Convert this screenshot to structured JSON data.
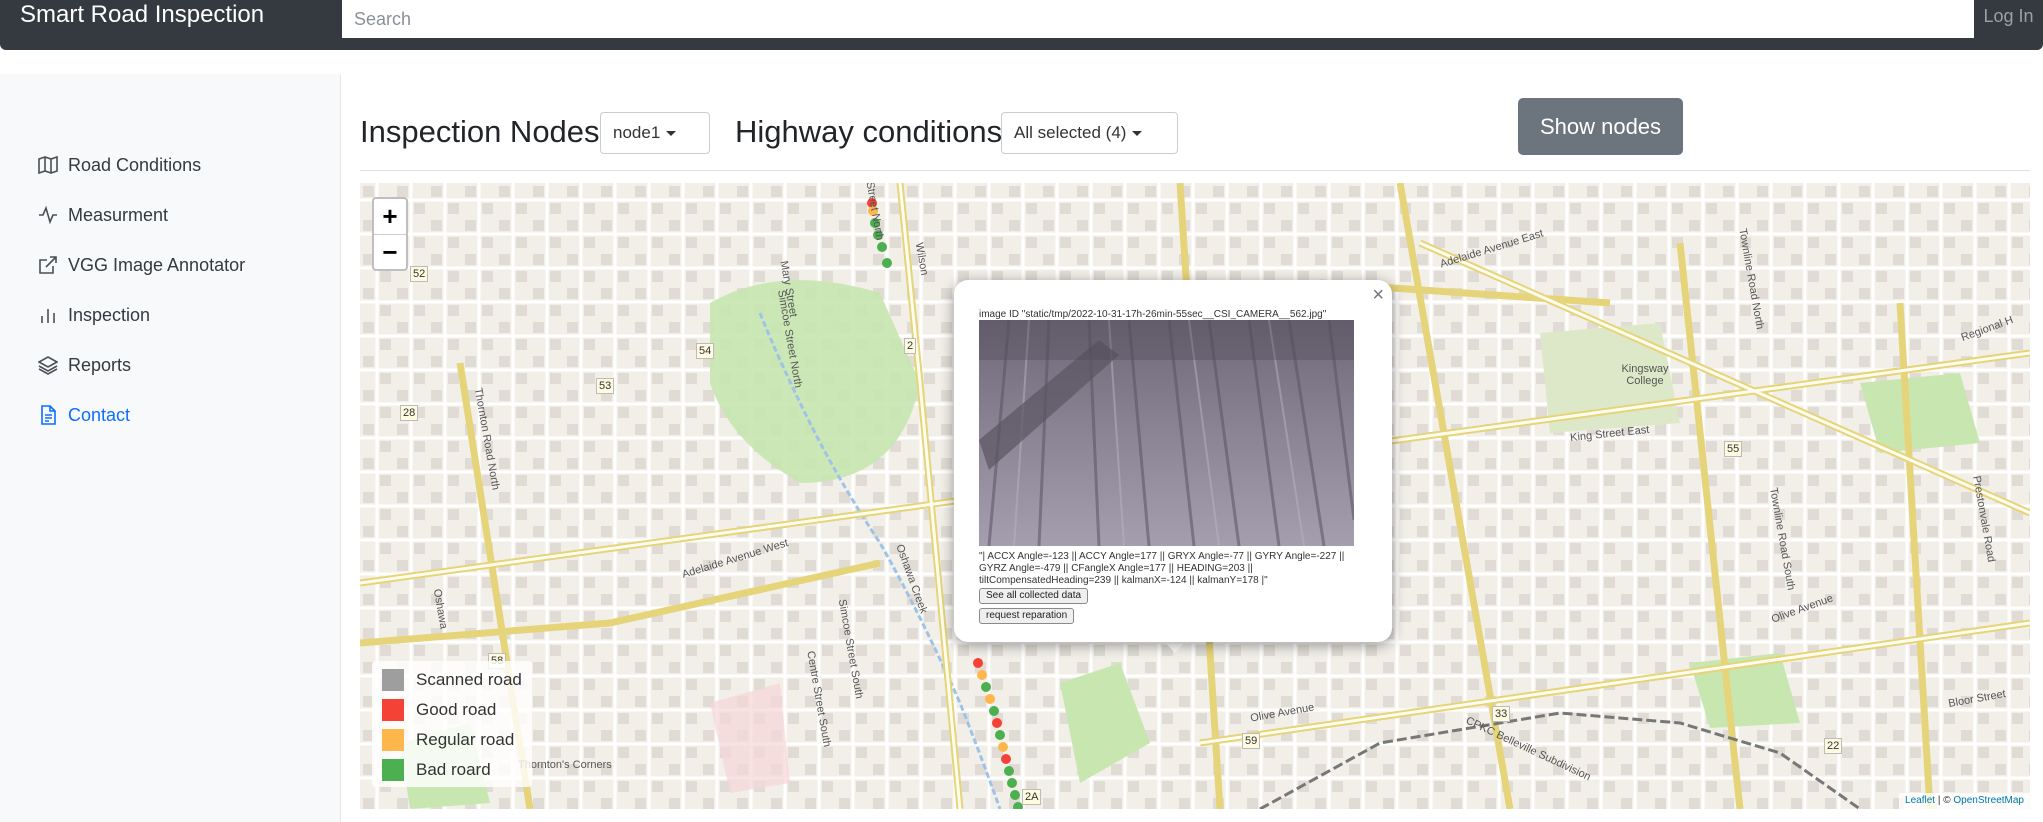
{
  "navbar": {
    "brand": "Smart Road Inspection",
    "search_placeholder": "Search",
    "login_label": "Log In"
  },
  "sidebar": {
    "items": [
      {
        "label": "Road Conditions",
        "icon": "map-icon"
      },
      {
        "label": "Measurment",
        "icon": "activity-icon"
      },
      {
        "label": "VGG Image Annotator",
        "icon": "external-link-icon"
      },
      {
        "label": "Inspection",
        "icon": "bar-chart-icon"
      },
      {
        "label": "Reports",
        "icon": "layers-icon"
      },
      {
        "label": "Contact",
        "icon": "file-text-icon",
        "active": true
      }
    ]
  },
  "header": {
    "inspection_title": "Inspection Nodes",
    "node_select": "node1",
    "highway_title": "Highway conditions",
    "highway_select": "All selected (4)",
    "show_nodes_label": "Show nodes"
  },
  "map": {
    "zoom_in": "+",
    "zoom_out": "−",
    "legend": [
      {
        "label": "Scanned road",
        "color": "#9e9e9e"
      },
      {
        "label": "Good road",
        "color": "#f44336"
      },
      {
        "label": "Regular road",
        "color": "#ffb74d"
      },
      {
        "label": "Bad roard",
        "color": "#4caf50"
      }
    ],
    "attribution_leaflet": "Leaflet",
    "attribution_sep": "| ©",
    "attribution_osm": "OpenStreetMap",
    "labels": {
      "adelaide_east": "Adelaide Avenue East",
      "adelaide_west": "Adelaide Avenue West",
      "king_east": "King Street East",
      "olive_avenue": "Olive Avenue",
      "olive_avenue_2": "Olive Avenue",
      "kingsway": "Kingsway College",
      "thornton_corners": "Thornton's Corners",
      "thornton_road": "Thornton Road North",
      "simcoe_north": "Simcoe Street North",
      "simcoe_south": "Simcoe Street South",
      "centre_south": "Centre Street South",
      "mary_street": "Mary Street",
      "wilson": "Wilson",
      "townline_north": "Townline Road North",
      "townline_south": "Townline Road South",
      "prestonvale": "Prestonvale Road",
      "bloor": "Bloor Street",
      "regional": "Regional H",
      "oshawa_creek": "Oshawa Creek",
      "cpkc": "CPKC Belleville Subdivision",
      "street_north": "Street North",
      "oshawa": "Oshawa"
    },
    "shields": [
      "52",
      "54",
      "53",
      "28",
      "2",
      "58",
      "59",
      "33",
      "55",
      "22",
      "2A"
    ]
  },
  "popup": {
    "image_id": "image ID \"static/tmp/2022-10-31-17h-26min-55sec__CSI_CAMERA__562.jpg\"",
    "data_text": "\"| ACCX Angle=-123 || ACCY Angle=177 || GRYX Angle=-77 || GYRY Angle=-227 || GYRZ Angle=-479 || CFangleX Angle=177 || HEADING=203 || tiltCompensatedHeading=239 || kalmanX=-124 || kalmanY=178 |\"",
    "see_all_label": "See all collected data",
    "request_label": "request reparation",
    "close_label": "×"
  }
}
